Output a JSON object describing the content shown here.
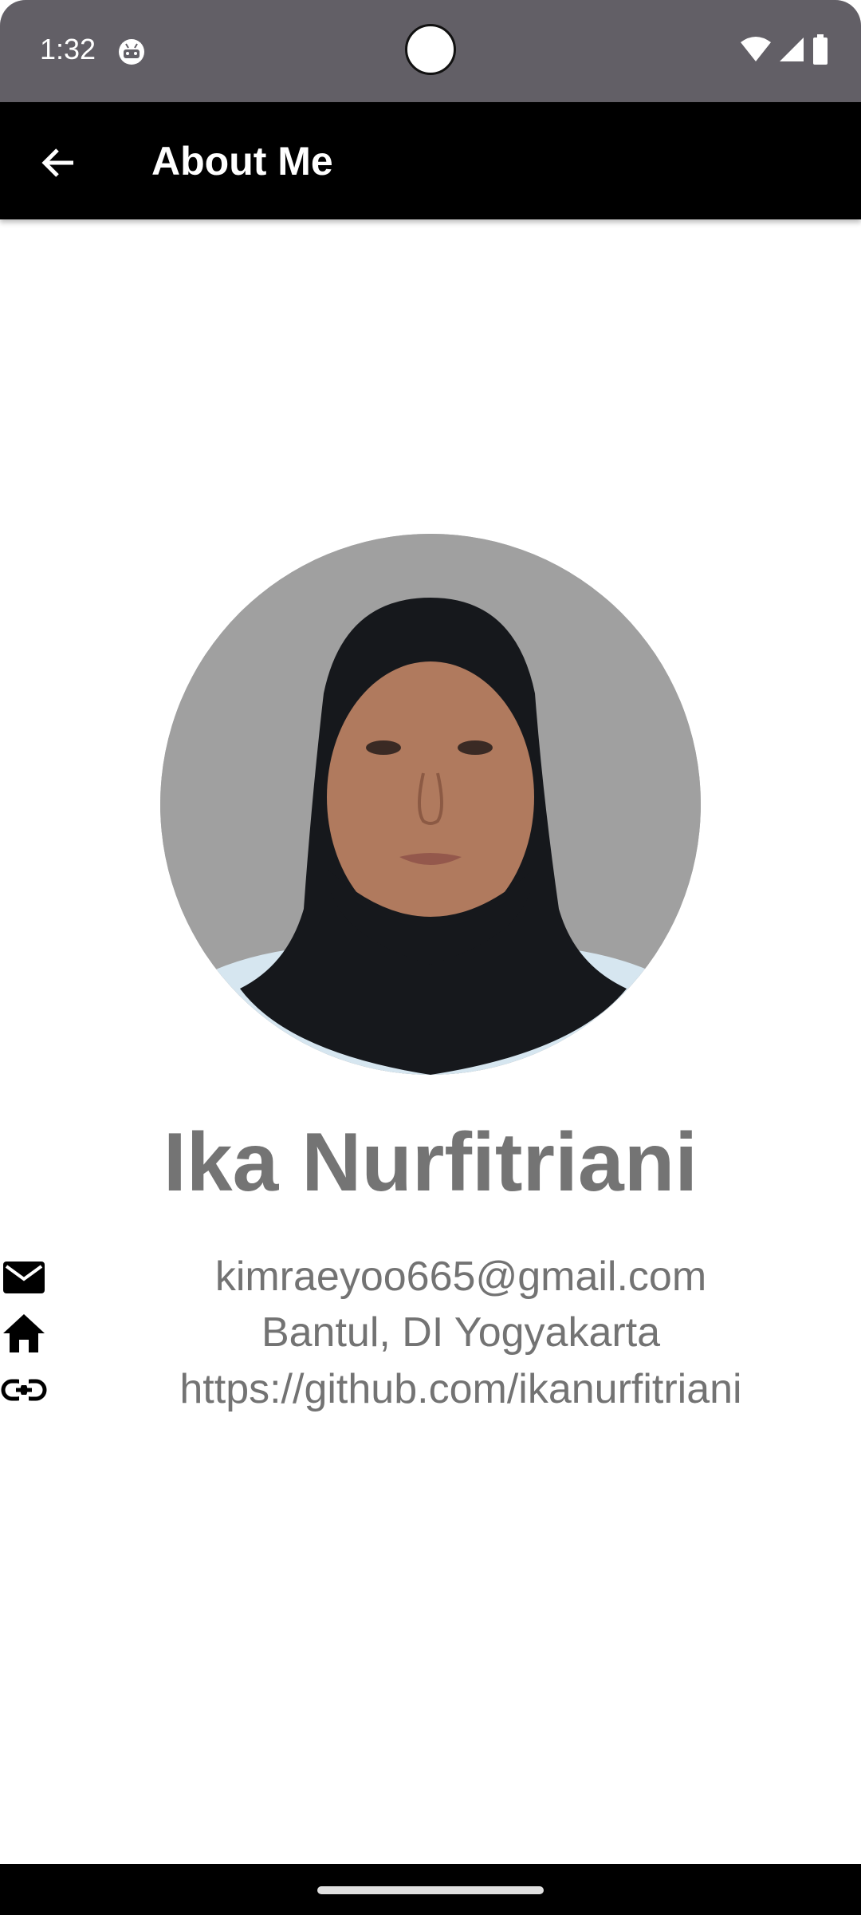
{
  "status_bar": {
    "time": "1:32",
    "app_icon": "android-robot-icon",
    "icons": [
      "wifi-icon",
      "signal-icon",
      "battery-icon"
    ]
  },
  "app_bar": {
    "title": "About Me",
    "back_icon": "arrow-back-icon"
  },
  "profile": {
    "name": "Ika Nurfitriani",
    "photo": "profile-photo"
  },
  "info": [
    {
      "icon": "email-icon",
      "text": "kimraeyoo665@gmail.com"
    },
    {
      "icon": "home-icon",
      "text": "Bantul, DI Yogyakarta"
    },
    {
      "icon": "link-icon",
      "text": "https://github.com/ikanurfitriani"
    }
  ],
  "colors": {
    "status_bar": "#625f66",
    "app_bar": "#000000",
    "text_gray": "#737373",
    "avatar_bg": "#a0a0a0"
  }
}
